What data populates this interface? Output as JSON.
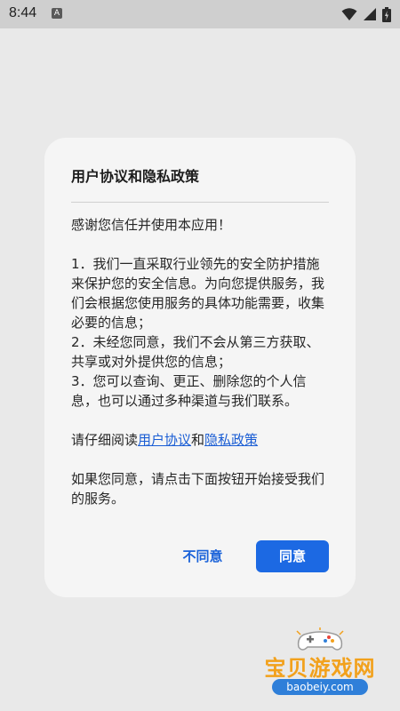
{
  "status_bar": {
    "time": "8:44",
    "notification_letter": "A"
  },
  "dialog": {
    "title": "用户协议和隐私政策",
    "greeting": "感谢您信任并使用本应用！",
    "items": [
      "1．我们一直采取行业领先的安全防护措施来保护您的安全信息。为向您提供服务，我们会根据您使用服务的具体功能需要，收集必要的信息；",
      "2．未经您同意，我们不会从第三方获取、共享或对外提供您的信息；",
      "3．您可以查询、更正、删除您的个人信息，也可以通过多种渠道与我们联系。"
    ],
    "read_prefix": "请仔细阅读",
    "user_agreement_link": "用户协议",
    "read_conjunction": "和",
    "privacy_policy_link": "隐私政策",
    "consent_text": "如果您同意，请点击下面按钮开始接受我们的服务。",
    "disagree_label": "不同意",
    "agree_label": "同意"
  },
  "watermark": {
    "brand": "宝贝游戏网",
    "url": "baobeiy.com"
  },
  "colors": {
    "accent": "#1c69e3",
    "link": "#1a5dd4",
    "watermark_orange": "#f2a11c"
  }
}
